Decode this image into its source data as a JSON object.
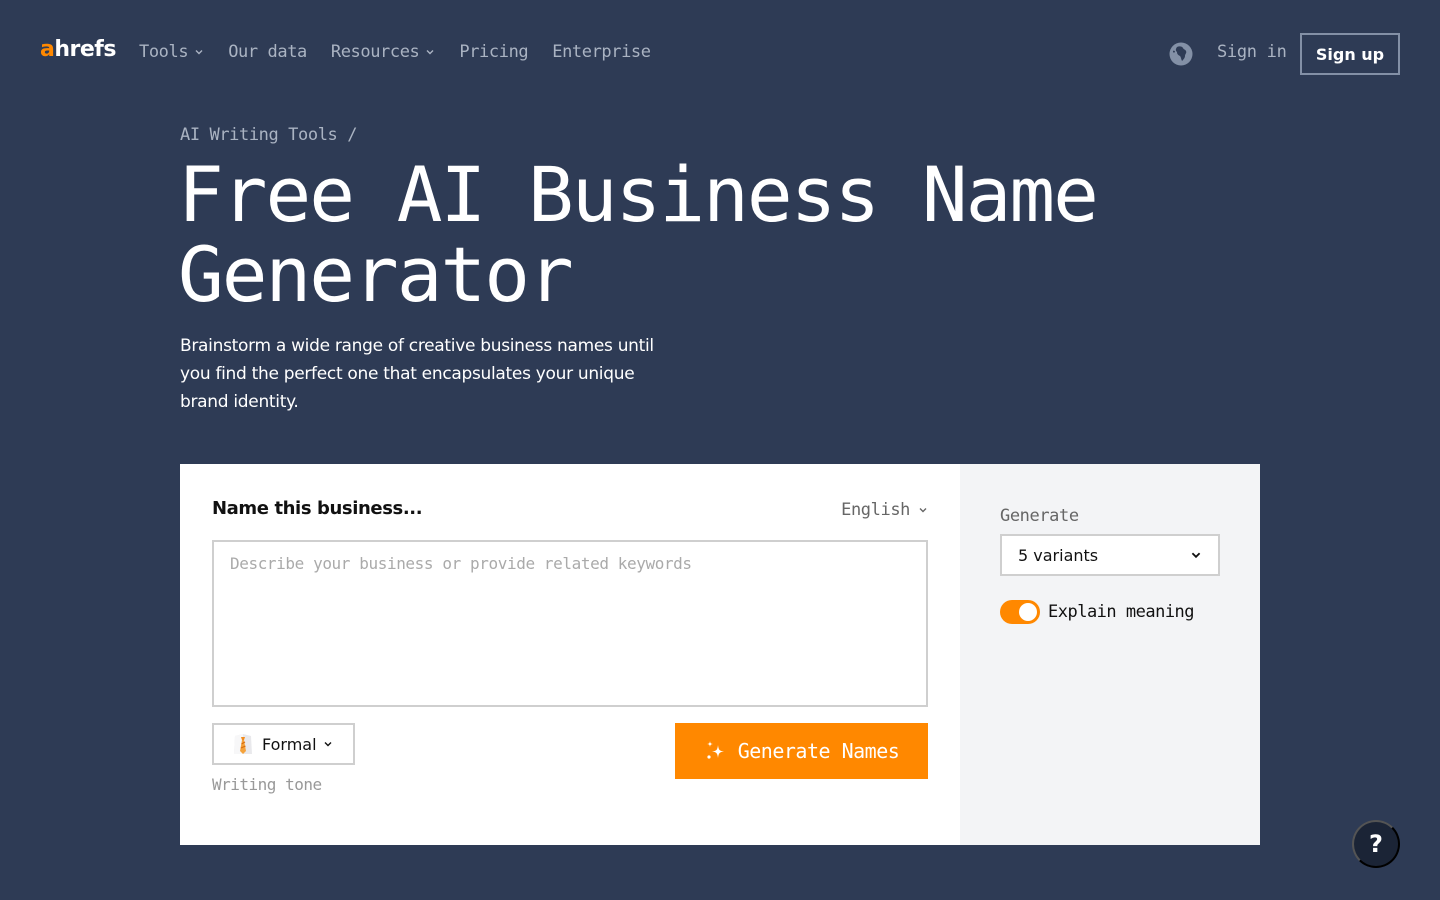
{
  "header": {
    "logo": {
      "accent": "a",
      "rest": "hrefs"
    },
    "nav": [
      {
        "label": "Tools",
        "has_dropdown": true
      },
      {
        "label": "Our data",
        "has_dropdown": false
      },
      {
        "label": "Resources",
        "has_dropdown": true
      },
      {
        "label": "Pricing",
        "has_dropdown": false
      },
      {
        "label": "Enterprise",
        "has_dropdown": false
      }
    ],
    "language_icon": "globe-icon",
    "sign_in": "Sign in",
    "sign_up": "Sign up"
  },
  "hero": {
    "breadcrumb": "AI Writing Tools /",
    "title_line1": "Free AI Business Name",
    "title_line2": "Generator",
    "subtitle": "Brainstorm a wide range of creative business names until you find the perfect one that encapsulates your unique brand identity."
  },
  "form": {
    "label": "Name this business...",
    "language": "English",
    "textarea_value": "",
    "textarea_placeholder": "Describe your business or provide related keywords",
    "tone": {
      "value": "Formal",
      "icon": "necktie-icon",
      "caption": "Writing tone"
    },
    "generate_button": "Generate Names"
  },
  "options": {
    "generate_label": "Generate",
    "variants_value": "5 variants",
    "explain_meaning": {
      "label": "Explain meaning",
      "enabled": true
    }
  },
  "help_button": "?",
  "colors": {
    "background": "#2e3b55",
    "accent": "#ff8800",
    "nav_text": "#aab3c2",
    "panel_gray": "#f3f4f6",
    "help_bg": "#1b2436"
  }
}
